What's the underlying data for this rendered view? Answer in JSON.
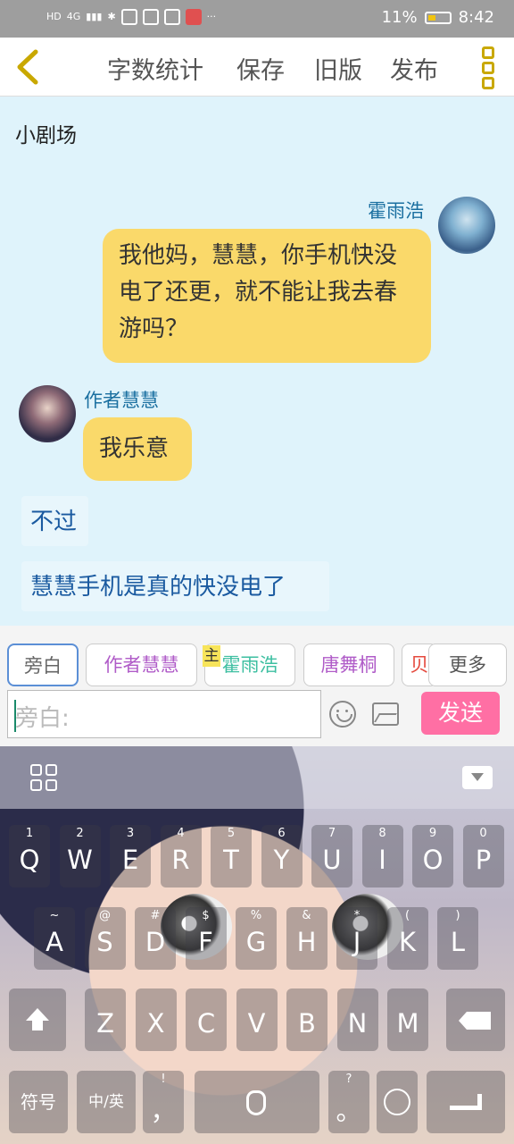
{
  "status_bar": {
    "left_icons": [
      "HD",
      "4G",
      "signal-icon",
      "lightbulb-icon",
      "browser-icon",
      "battery-small-icon",
      "huawei-icon",
      "book-icon",
      "more-dots-icon"
    ],
    "hd": "HD",
    "network": "4G",
    "more": "···",
    "battery_percent": "11%",
    "time": "8:42"
  },
  "nav": {
    "back_icon": "chevron-left-icon",
    "word_count": "字数统计",
    "save": "保存",
    "old_version": "旧版",
    "publish": "发布",
    "menu_icon": "vertical-dots-icon"
  },
  "chat": {
    "title": "小剧场",
    "messages": [
      {
        "speaker": "霍雨浩",
        "side": "right",
        "text": "我他妈，慧慧，你手机快没电了还更，就不能让我去春游吗？"
      },
      {
        "speaker": "作者慧慧",
        "side": "left",
        "text": "我乐意"
      },
      {
        "speaker": "",
        "side": "narration",
        "text": "不过"
      },
      {
        "speaker": "",
        "side": "narration",
        "text": "慧慧手机是真的快没电了"
      }
    ]
  },
  "roles": {
    "items": [
      "旁白",
      "作者慧慧",
      "霍雨浩",
      "唐舞桐",
      "贝"
    ],
    "master_badge": "主",
    "more": "更多"
  },
  "composer": {
    "placeholder": "旁白:",
    "send": "发送",
    "emoji_icon": "emoji-icon",
    "image_icon": "image-icon"
  },
  "keyboard": {
    "row1": [
      {
        "k": "Q",
        "s": "1"
      },
      {
        "k": "W",
        "s": "2"
      },
      {
        "k": "E",
        "s": "3"
      },
      {
        "k": "R",
        "s": "4"
      },
      {
        "k": "T",
        "s": "5"
      },
      {
        "k": "Y",
        "s": "6"
      },
      {
        "k": "U",
        "s": "7"
      },
      {
        "k": "I",
        "s": "8"
      },
      {
        "k": "O",
        "s": "9"
      },
      {
        "k": "P",
        "s": "0"
      }
    ],
    "row2": [
      {
        "k": "A",
        "s": "~"
      },
      {
        "k": "S",
        "s": "@"
      },
      {
        "k": "D",
        "s": "#"
      },
      {
        "k": "F",
        "s": "$"
      },
      {
        "k": "G",
        "s": "%"
      },
      {
        "k": "H",
        "s": "&"
      },
      {
        "k": "J",
        "s": "*"
      },
      {
        "k": "K",
        "s": "("
      },
      {
        "k": "L",
        "s": ")"
      }
    ],
    "row3": [
      {
        "k": "Z",
        "s": ""
      },
      {
        "k": "X",
        "s": ""
      },
      {
        "k": "C",
        "s": ""
      },
      {
        "k": "V",
        "s": ""
      },
      {
        "k": "B",
        "s": ""
      },
      {
        "k": "N",
        "s": ""
      },
      {
        "k": "M",
        "s": ""
      }
    ],
    "symbols": "符号",
    "lang": "中/英",
    "comma": "，",
    "period": "。",
    "comma_sub": "!",
    "period_sub": "?"
  },
  "colors": {
    "chat_bg": "#dff3fb",
    "bubble": "#fad96a",
    "send": "#ff6fa4",
    "accent": "#c9a800"
  }
}
